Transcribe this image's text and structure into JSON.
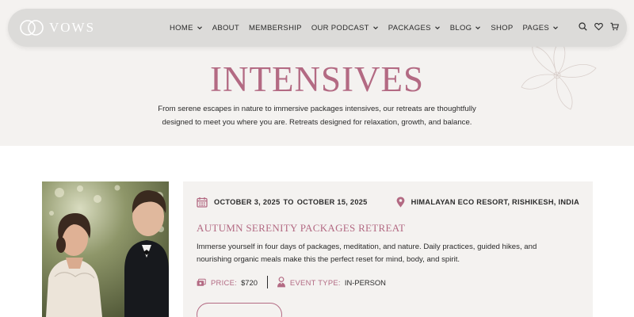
{
  "nav": {
    "logo_text": "VOWS",
    "items": [
      {
        "label": "HOME",
        "has_dropdown": true
      },
      {
        "label": "ABOUT",
        "has_dropdown": false
      },
      {
        "label": "MEMBERSHIP",
        "has_dropdown": false
      },
      {
        "label": "OUR PODCAST",
        "has_dropdown": true
      },
      {
        "label": "PACKAGES",
        "has_dropdown": true
      },
      {
        "label": "BLOG",
        "has_dropdown": true
      },
      {
        "label": "SHOP",
        "has_dropdown": false
      },
      {
        "label": "PAGES",
        "has_dropdown": true
      }
    ],
    "icons": [
      "search-icon",
      "heart-icon",
      "cart-icon"
    ]
  },
  "hero": {
    "title": "INTENSIVES",
    "intro_line1": "From serene escapes in nature to immersive packages intensives, our retreats are thoughtfully",
    "intro_line2": "designed to meet you where you are. Retreats designed for relaxation, growth, and balance."
  },
  "event": {
    "date_start": "OCTOBER 3, 2025",
    "date_to": "TO",
    "date_end": "OCTOBER 15, 2025",
    "location": "HIMALAYAN ECO RESORT, RISHIKESH, INDIA",
    "title": "Autumn Serenity Packages Retreat",
    "description_line1": "Immerse yourself in four days of packages, meditation, and nature. Daily practices, guided hikes, and",
    "description_line2": "nourishing organic meals make this the perfect reset for mind, body, and spirit.",
    "price_label": "PRICE:",
    "price_value": "$720",
    "type_label": "EVENT TYPE:",
    "type_value": "IN-PERSON",
    "photo_description": "wedding couple"
  },
  "colors": {
    "accent": "#b36a83",
    "hero_bg": "#f4f2f0",
    "nav_bg": "#dcdbd9",
    "text": "#2b2b2b"
  }
}
